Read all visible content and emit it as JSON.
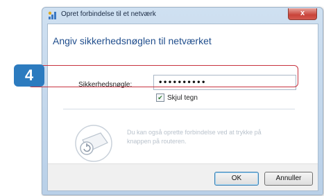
{
  "window": {
    "title": "Opret forbindelse til et netværk",
    "close_glyph": "x"
  },
  "dialog": {
    "heading": "Angiv sikkerhedsnøglen til netværket",
    "security_key_label": "Sikkerhedsnøgle:",
    "security_key_value": "••••••••••",
    "hide_characters_label": "Skjul tegn",
    "hide_characters_checked": true,
    "router_hint": "Du kan også oprette forbindelse ved at trykke på knappen på routeren."
  },
  "buttons": {
    "ok": "OK",
    "cancel": "Annuller"
  },
  "callout": {
    "step_number": "4",
    "badge_color": "#2c7bbf",
    "frame_color": "#c8323e"
  },
  "icons": {
    "app": "network-icon",
    "router": "router-push-button-icon",
    "check": "checkmark-icon"
  }
}
